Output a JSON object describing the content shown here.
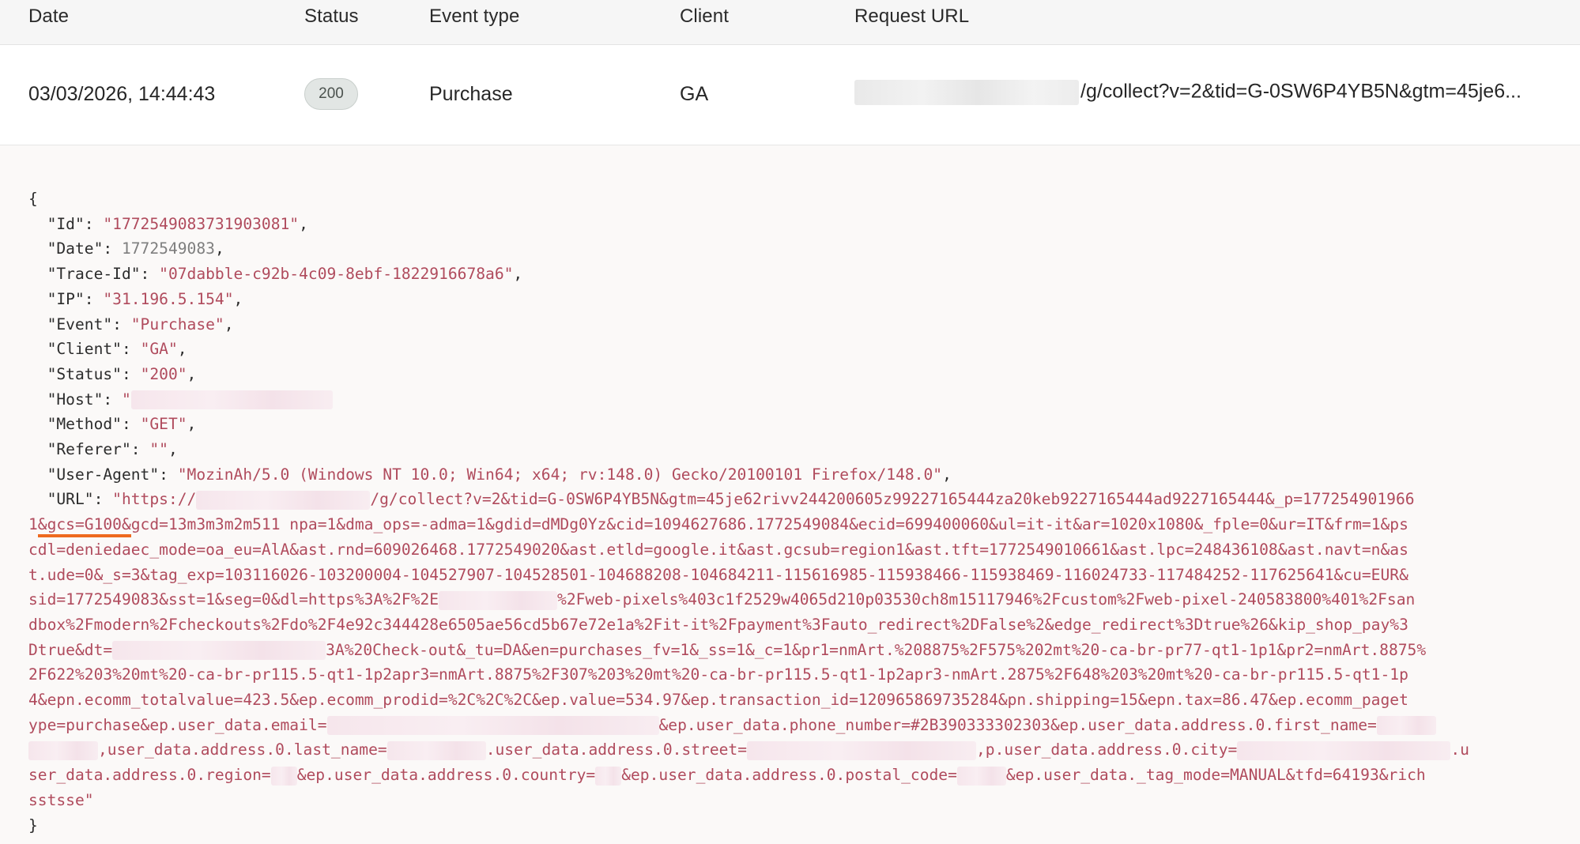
{
  "table": {
    "headers": [
      "Date",
      "Status",
      "Event type",
      "Client",
      "Request URL"
    ],
    "row": {
      "date": "03/03/2026, 14:44:43",
      "status": "200",
      "event_type": "Purchase",
      "client": "GA",
      "request_url": "/g/collect?v=2&tid=G-0SW6P4YB5N&gtm=45je6..."
    }
  },
  "detail": {
    "open_brace": "{",
    "close_brace": "}",
    "fields": [
      {
        "key": "\"Id\": ",
        "value": "\"1772549083731903081\"",
        "type": "str",
        "comma": ","
      },
      {
        "key": "\"Date\": ",
        "value": "1772549083",
        "type": "num",
        "comma": ","
      },
      {
        "key": "\"Trace-Id\": ",
        "value": "\"07dabble-c92b-4c09-8ebf-1822916678a6\"",
        "type": "str",
        "comma": ","
      },
      {
        "key": "\"IP\": ",
        "value": "\"31.196.5.154\"",
        "type": "str",
        "comma": ","
      },
      {
        "key": "\"Event\": ",
        "value": "\"Purchase\"",
        "type": "str",
        "comma": ","
      },
      {
        "key": "\"Client\": ",
        "value": "\"GA\"",
        "type": "str",
        "comma": ","
      },
      {
        "key": "\"Status\": ",
        "value": "\"200\"",
        "type": "str",
        "comma": ","
      },
      {
        "key": "\"Host\": ",
        "value": "\"",
        "type": "str",
        "comma": ""
      },
      {
        "key": "\"Method\": ",
        "value": "\"GET\"",
        "type": "str",
        "comma": ","
      },
      {
        "key": "\"Referer\": ",
        "value": "\"\"",
        "type": "str",
        "comma": ","
      },
      {
        "key": "\"User-Agent\": ",
        "value": "\"MozinAh/5.0 (Windows NT 10.0; Win64; x64; rv:148.0) Gecko/20100101 Firefox/148.0\"",
        "type": "str",
        "comma": ","
      }
    ],
    "url_key": "\"URL\": ",
    "url_lines": [
      {
        "parts": [
          "\"https://",
          "[R]",
          "/g/collect?v=2&tid=G-0SW6P4YB5N&gtm=45je62rivv244200605z99227165444za20keb9227165444ad9227165444&_p=177254901966"
        ]
      },
      {
        "parts": [
          "1",
          "[HL]&gcs=G100&",
          "gcd=13m3m3m2m511 npa=1&dma_ops=-adma=1&gdid=dMDg0Yz&cid=1094627686.1772549084&ecid=699400060&ul=it-it&ar=1020x1080&_fple=0&ur=IT&frm=1&ps"
        ]
      },
      {
        "parts": [
          "cdl=deniedaec_mode=oa_eu=AlA&ast.rnd=609026468.1772549020&ast.etld=google.it&ast.gcsub=region1&ast.tft=1772549010661&ast.lpc=248436108&ast.navt=n&as"
        ]
      },
      {
        "parts": [
          "t.ude=0&_s=3&tag_exp=103116026-103200004-104527907-104528501-104688208-104684211-115616985-115938466-115938469-116024733-117484252-117625641&cu=EUR&"
        ]
      },
      {
        "parts": [
          "sid=1772549083&sst=1&seg=0&dl=https%3A%2F%2E",
          "[R]",
          "%2Fweb-pixels%403c1f2529w4065d210p03530ch8m15117946%2Fcustom%2Fweb-pixel-240583800%401%2Fsan"
        ]
      },
      {
        "parts": [
          "dbox%2Fmodern%2Fcheckouts%2Fdo%2F4e92c344428e6505ae56cd5b67e72e1a%2Fit-it%2Fpayment%3Fauto_redirect%2DFalse%2&edge_redirect%3Dtrue%26&kip_shop_pay%3"
        ]
      },
      {
        "parts": [
          "Dtrue&dt=",
          "[R]",
          "3A%20Check-out&_tu=DA&en=purchases_fv=1&_ss=1&_c=1&pr1=nmArt.%208875%2F575%202mt%20-ca-br-pr77-qt1-1p1&pr2=nmArt.8875%"
        ]
      },
      {
        "parts": [
          "2F622%203%20mt%20-ca-br-pr115.5-qt1-1p2apr3=nmArt.8875%2F307%203%20mt%20-ca-br-pr115.5-qt1-1p2apr3-nmArt.2875%2F648%203%20mt%20-ca-br-pr115.5-qt1-1p"
        ]
      },
      {
        "parts": [
          "4&epn.ecomm_totalvalue=423.5&ep.ecomm_prodid=%2C%2C%2C&ep.value=534.97&ep.transaction_id=120965869735284&pn.shipping=15&epn.tax=86.47&ep.ecomm_paget"
        ]
      },
      {
        "parts": [
          "ype=purchase&ep.user_data.email=",
          "[R]",
          "&ep.user_data.phone_number=#2B390333302303&ep.user_data.address.0.first_name=",
          "[R]"
        ]
      },
      {
        "parts": [
          "[R]",
          ",user_data.address.0.last_name=",
          "[R]",
          ".user_data.address.0.street=",
          "[R]",
          ",p.user_data.address.0.city=",
          "[R]",
          ".u"
        ]
      },
      {
        "parts": [
          "ser_data.address.0.region=",
          "[R]",
          "&ep.user_data.address.0.country=",
          "[R]",
          "&ep.user_data.address.0.postal_code=",
          "[R]",
          "&ep.user_data._tag_mode=MANUAL&tfd=64193&rich"
        ]
      },
      {
        "parts": [
          "sstsse\""
        ]
      }
    ],
    "colors": {
      "string": "#b04b5d",
      "number": "#7e7e7e",
      "highlight": "#ee6a1f"
    }
  }
}
